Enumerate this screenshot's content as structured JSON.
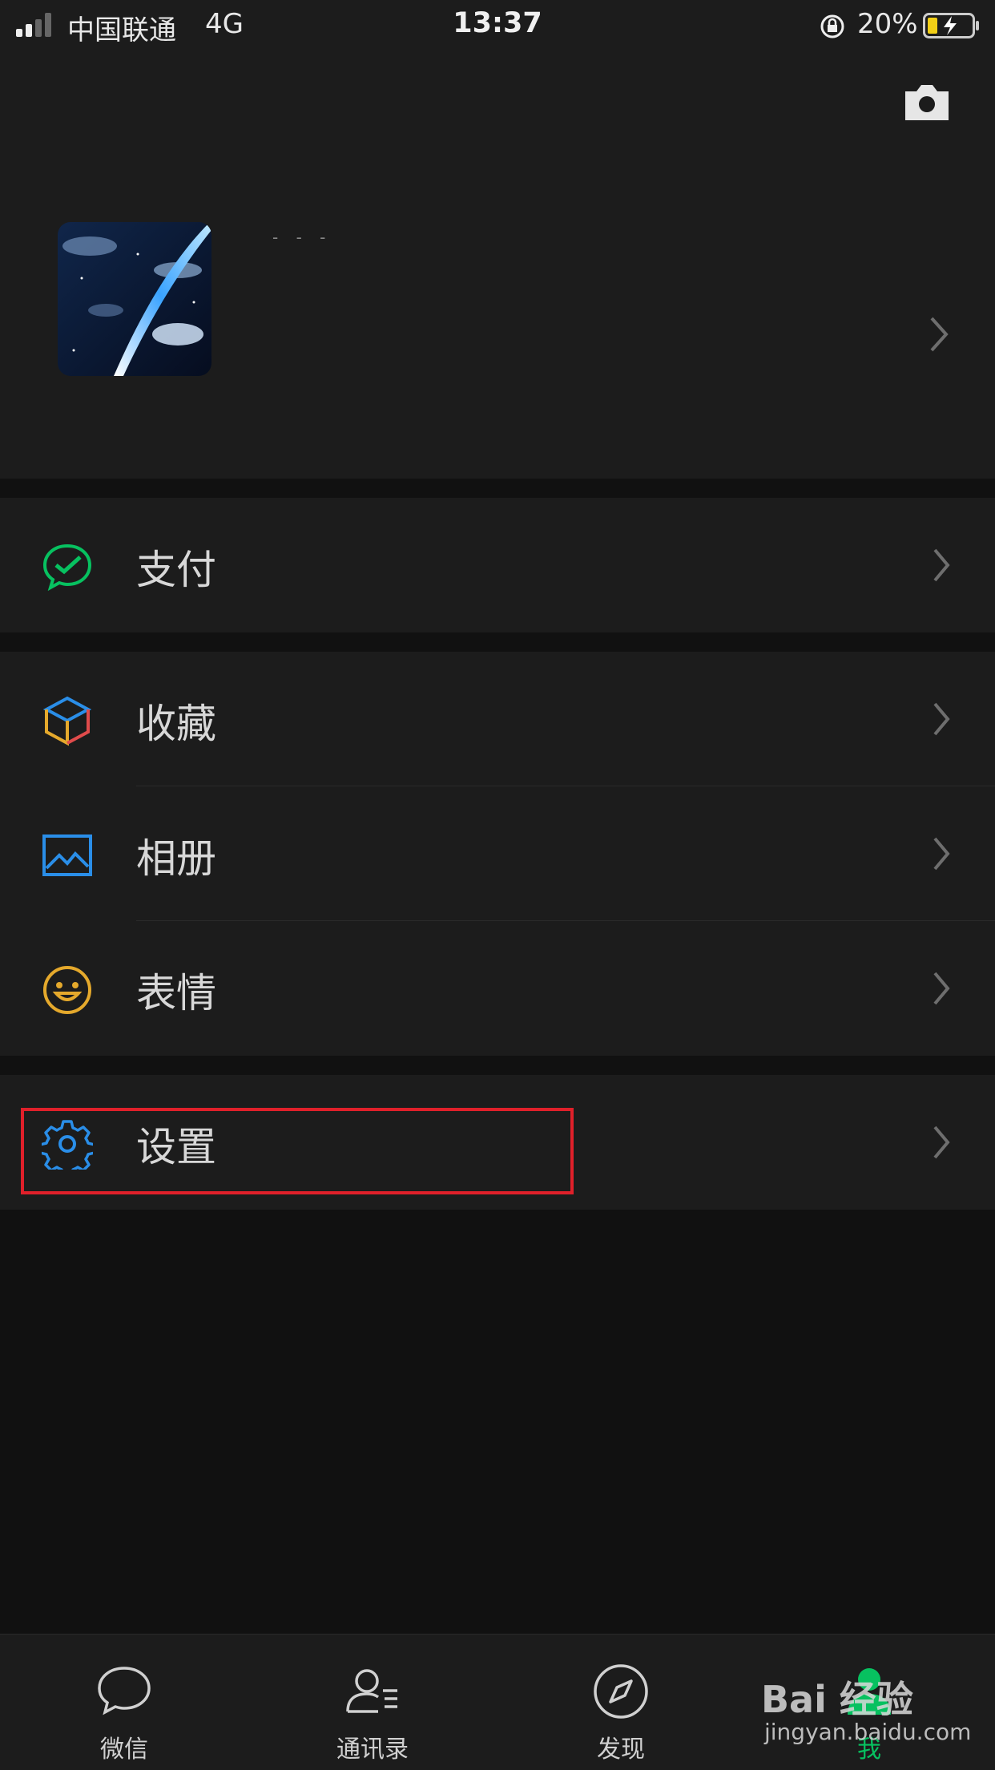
{
  "status_bar": {
    "carrier": "中国联通",
    "network": "4G",
    "time": "13:37",
    "battery_percent": "20%",
    "battery_level": 0.2
  },
  "profile": {
    "nickname": "- - -",
    "avatar_icon": "avatar-image-icon",
    "camera_icon": "camera-icon"
  },
  "menu": {
    "pay": "支付",
    "favorites": "收藏",
    "album": "相册",
    "stickers": "表情",
    "settings": "设置"
  },
  "tabs": [
    {
      "label": "微信",
      "icon": "chat-bubble-icon"
    },
    {
      "label": "通讯录",
      "icon": "contacts-icon"
    },
    {
      "label": "发现",
      "icon": "compass-icon"
    },
    {
      "label": "我",
      "icon": "me-icon"
    }
  ],
  "watermark": {
    "brand": "Bai 经验",
    "url": "jingyan.baidu.com"
  },
  "colors": {
    "background": "#111111",
    "surface": "#1c1c1c",
    "accent_green": "#07c160",
    "highlight_red": "#e0202a",
    "blue_icon": "#2a8ee8",
    "yellow_icon": "#e5a92c"
  }
}
